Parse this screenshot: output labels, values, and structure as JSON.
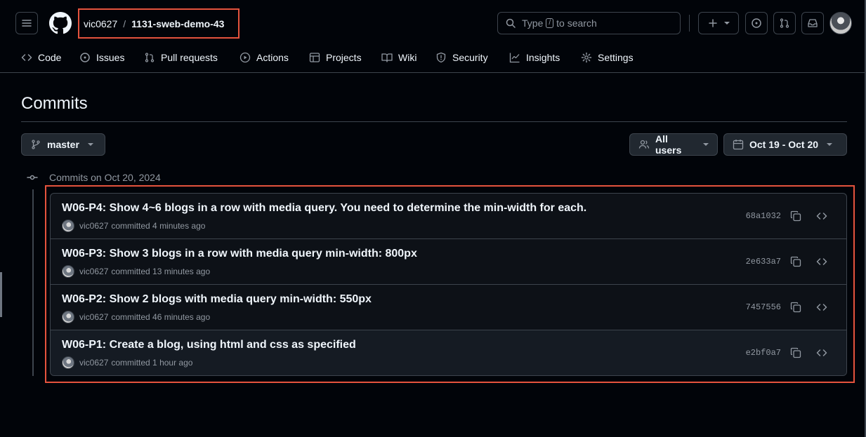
{
  "header": {
    "owner": "vic0627",
    "separator": "/",
    "repo": "1131-sweb-demo-43",
    "search_prefix": "Type",
    "search_key": "/",
    "search_suffix": "to search"
  },
  "nav": {
    "items": [
      {
        "label": "Code",
        "icon": "code-icon"
      },
      {
        "label": "Issues",
        "icon": "issue-icon"
      },
      {
        "label": "Pull requests",
        "icon": "pull-request-icon"
      },
      {
        "label": "Actions",
        "icon": "play-icon"
      },
      {
        "label": "Projects",
        "icon": "table-icon"
      },
      {
        "label": "Wiki",
        "icon": "book-icon"
      },
      {
        "label": "Security",
        "icon": "shield-icon"
      },
      {
        "label": "Insights",
        "icon": "graph-icon"
      },
      {
        "label": "Settings",
        "icon": "gear-icon"
      }
    ]
  },
  "page": {
    "title": "Commits"
  },
  "filters": {
    "branch": "master",
    "users": "All users",
    "date_range": "Oct 19 - Oct 20"
  },
  "group": {
    "heading": "Commits on Oct 20, 2024"
  },
  "commits": [
    {
      "message": "W06-P4: Show 4~6 blogs in a row with media query. You need to determine the min-width for each.",
      "author": "vic0627",
      "when": "committed 4 minutes ago",
      "sha": "68a1032"
    },
    {
      "message": "W06-P3: Show 3 blogs in a row with media query min-width: 800px",
      "author": "vic0627",
      "when": "committed 13 minutes ago",
      "sha": "2e633a7"
    },
    {
      "message": "W06-P2: Show 2 blogs with media query min-width: 550px",
      "author": "vic0627",
      "when": "committed 46 minutes ago",
      "sha": "7457556"
    },
    {
      "message": "W06-P1: Create a blog, using html and css as specified",
      "author": "vic0627",
      "when": "committed 1 hour ago",
      "sha": "e2bf0a7"
    }
  ],
  "colors": {
    "background": "#010409",
    "border": "#3d444d",
    "highlight": "#e5533d",
    "text": "#f0f6fc",
    "muted": "#9198a1"
  }
}
